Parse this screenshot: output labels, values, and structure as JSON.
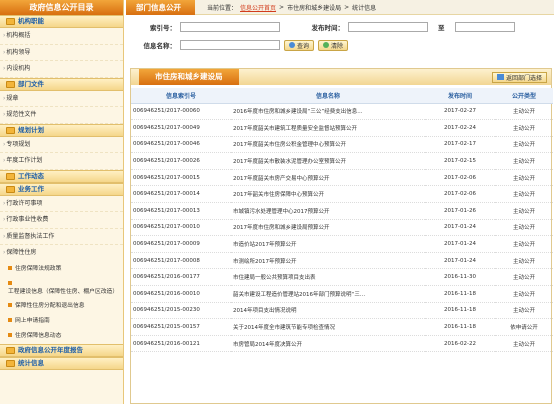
{
  "sidebar": {
    "title": "政府信息公开目录",
    "sections": [
      {
        "label": "机构职能",
        "items": [
          "机构概括",
          "机构领导",
          "内设机构"
        ]
      },
      {
        "label": "部门文件",
        "items": [
          "规章",
          "规范性文件"
        ]
      },
      {
        "label": "规划计划",
        "items": [
          "专项规划",
          "年度工作计划"
        ]
      },
      {
        "label": "工作动态",
        "items": []
      },
      {
        "label": "业务工作",
        "items": [
          "行政许可事项",
          "行政事业性收费",
          "质量监督执法工作",
          "保障性住房"
        ]
      }
    ],
    "subitems": [
      "住房保障法规政策",
      "工程建设信息（保障性住房、棚户区改造）",
      "保障性住房分配和退出信息",
      "网上申请指南",
      "住房保障信息动态"
    ],
    "bottom_sections": [
      "政府信息公开年度报告",
      "统计信息"
    ]
  },
  "topbar": {
    "title": "部门信息公开",
    "crumb_prefix": "当前位置：",
    "crumb_link": "信息公开首页",
    "crumb_sep1": ">",
    "crumb_mid": "市住房和城乡建设局",
    "crumb_sep2": ">",
    "crumb_last": "统计信息"
  },
  "search": {
    "index_label": "索引号：",
    "date_label": "发布时间：",
    "to_label": "至",
    "name_label": "信息名称：",
    "query_btn": "查询",
    "clear_btn": "清除"
  },
  "panel": {
    "tab": "市住房和城乡建设局",
    "back_btn": "返回部门选择",
    "columns": [
      "信息索引号",
      "信息名称",
      "发布时间",
      "公开类型"
    ],
    "rows": [
      [
        "006946251/2017-00060",
        "2016年度市住房和城乡建设局“三公”经费支出信息...",
        "2017-02-27",
        "主动公开"
      ],
      [
        "006946251/2017-00049",
        "2017年度韶关市建筑工程质量安全监督站预算公开",
        "2017-02-24",
        "主动公开"
      ],
      [
        "006946251/2017-00046",
        "2017年度韶关市住房公积金管理中心预算公开",
        "2017-02-17",
        "主动公开"
      ],
      [
        "006946251/2017-00026",
        "2017年度韶关市散装水泥管理办公室预算公开",
        "2017-02-15",
        "主动公开"
      ],
      [
        "006946251/2017-00015",
        "2017年度韶关市房产交易中心预算公开",
        "2017-02-06",
        "主动公开"
      ],
      [
        "006946251/2017-00014",
        "2017年韶关市住房保障中心预算公开",
        "2017-02-06",
        "主动公开"
      ],
      [
        "006946251/2017-00013",
        "市城镇污水处理管理中心2017预算公开",
        "2017-01-26",
        "主动公开"
      ],
      [
        "006946251/2017-00010",
        "2017年度市住房和城乡建设局预算公开",
        "2017-01-24",
        "主动公开"
      ],
      [
        "006946251/2017-00009",
        "市造价站2017年预算公开",
        "2017-01-24",
        "主动公开"
      ],
      [
        "006946251/2017-00008",
        "市测绘所2017年预算公开",
        "2017-01-24",
        "主动公开"
      ],
      [
        "006946251/2016-00177",
        "市住建局一般公共预算项目支出表",
        "2016-11-30",
        "主动公开"
      ],
      [
        "006946251/2016-00010",
        "韶关市建设工程造价管理站2016年部门预算说明“三...",
        "2016-11-18",
        "主动公开"
      ],
      [
        "006946251/2015-00230",
        "2014年项目支出情况说明",
        "2016-11-18",
        "主动公开"
      ],
      [
        "006946251/2015-00157",
        "关于2014年度全市建筑节能专项检查情况",
        "2016-11-18",
        "依申请公开"
      ],
      [
        "006946251/2016-00121",
        "市房管局2014年度决算公开",
        "2016-02-22",
        "主动公开"
      ]
    ]
  }
}
